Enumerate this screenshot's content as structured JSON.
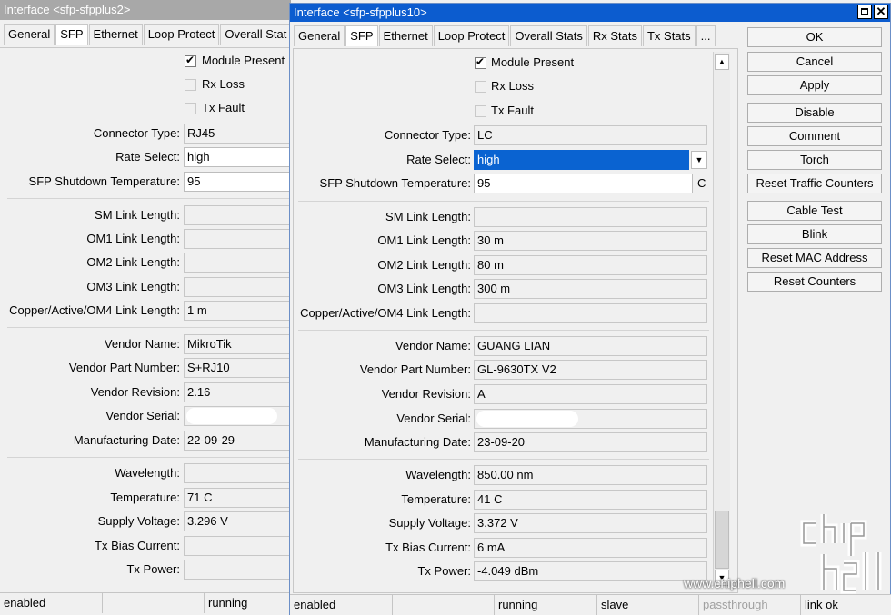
{
  "colors": {
    "title_bar": "#0c5ccf",
    "title_bar_inactive": "#a8a8a8",
    "selection": "#0a63d1"
  },
  "back_window": {
    "title": "Interface <sfp-sfpplus2>",
    "tabs": [
      "General",
      "SFP",
      "Ethernet",
      "Loop Protect",
      "Overall Stat"
    ],
    "active_tab": "SFP",
    "checkboxes": [
      {
        "label": "Module Present",
        "checked": true
      },
      {
        "label": "Rx Loss",
        "checked": false
      },
      {
        "label": "Tx Fault",
        "checked": false
      }
    ],
    "fields": [
      {
        "label": "Connector Type:",
        "value": "RJ45"
      },
      {
        "label": "Rate Select:",
        "value": "high"
      },
      {
        "label": "SFP Shutdown Temperature:",
        "value": "95"
      },
      {
        "label": "SM Link Length:",
        "value": ""
      },
      {
        "label": "OM1 Link Length:",
        "value": ""
      },
      {
        "label": "OM2 Link Length:",
        "value": ""
      },
      {
        "label": "OM3 Link Length:",
        "value": ""
      },
      {
        "label": "Copper/Active/OM4 Link Length:",
        "value": "1 m"
      },
      {
        "label": "Vendor Name:",
        "value": "MikroTik"
      },
      {
        "label": "Vendor Part Number:",
        "value": "S+RJ10"
      },
      {
        "label": "Vendor Revision:",
        "value": "2.16"
      },
      {
        "label": "Vendor Serial:",
        "value": ""
      },
      {
        "label": "Manufacturing Date:",
        "value": "22-09-29"
      },
      {
        "label": "Wavelength:",
        "value": ""
      },
      {
        "label": "Temperature:",
        "value": "71 C"
      },
      {
        "label": "Supply Voltage:",
        "value": "3.296 V"
      },
      {
        "label": "Tx Bias Current:",
        "value": ""
      },
      {
        "label": "Tx Power:",
        "value": ""
      }
    ],
    "status": [
      "enabled",
      "",
      "running"
    ]
  },
  "front_window": {
    "title": "Interface <sfp-sfpplus10>",
    "tabs": [
      "General",
      "SFP",
      "Ethernet",
      "Loop Protect",
      "Overall Stats",
      "Rx Stats",
      "Tx Stats",
      "..."
    ],
    "active_tab": "SFP",
    "checkboxes": [
      {
        "label": "Module Present",
        "checked": true
      },
      {
        "label": "Rx Loss",
        "checked": false
      },
      {
        "label": "Tx Fault",
        "checked": false
      }
    ],
    "fields": [
      {
        "label": "Connector Type:",
        "value": "LC"
      },
      {
        "label": "Rate Select:",
        "value": "high"
      },
      {
        "label": "SFP Shutdown Temperature:",
        "value": "95",
        "unit": "C"
      },
      {
        "label": "SM Link Length:",
        "value": ""
      },
      {
        "label": "OM1 Link Length:",
        "value": "30 m"
      },
      {
        "label": "OM2 Link Length:",
        "value": "80 m"
      },
      {
        "label": "OM3 Link Length:",
        "value": "300 m"
      },
      {
        "label": "Copper/Active/OM4 Link Length:",
        "value": ""
      },
      {
        "label": "Vendor Name:",
        "value": "GUANG LIAN"
      },
      {
        "label": "Vendor Part Number:",
        "value": "GL-9630TX V2"
      },
      {
        "label": "Vendor Revision:",
        "value": "A"
      },
      {
        "label": "Vendor Serial:",
        "value": ""
      },
      {
        "label": "Manufacturing Date:",
        "value": "23-09-20"
      },
      {
        "label": "Wavelength:",
        "value": "850.00 nm"
      },
      {
        "label": "Temperature:",
        "value": "41 C"
      },
      {
        "label": "Supply Voltage:",
        "value": "3.372 V"
      },
      {
        "label": "Tx Bias Current:",
        "value": "6 mA"
      },
      {
        "label": "Tx Power:",
        "value": "-4.049 dBm"
      }
    ],
    "buttons": [
      "OK",
      "Cancel",
      "Apply",
      "Disable",
      "Comment",
      "Torch",
      "Reset Traffic Counters",
      "Cable Test",
      "Blink",
      "Reset MAC Address",
      "Reset Counters"
    ],
    "status": [
      "enabled",
      "",
      "running",
      "slave",
      "passthrough",
      "link ok"
    ],
    "watermark": "www.chiphell.com"
  }
}
